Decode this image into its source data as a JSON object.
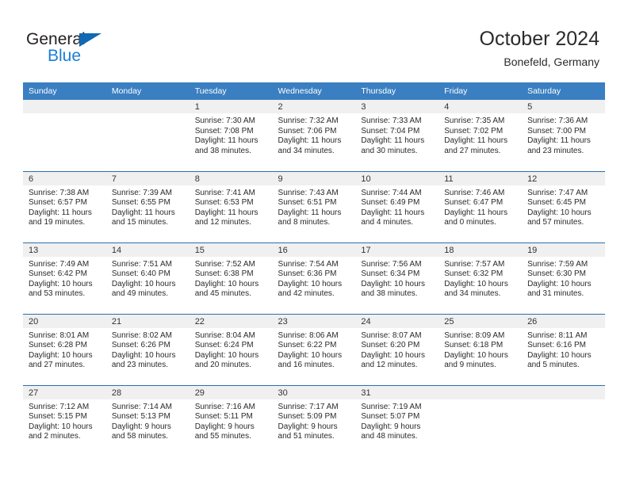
{
  "brand": {
    "name_top": "General",
    "name_bottom": "Blue",
    "color_dark": "#231f20",
    "color_blue": "#1a7fd4"
  },
  "header": {
    "title": "October 2024",
    "subtitle": "Bonefeld, Germany"
  },
  "colors": {
    "header_band": "#3a7fc1",
    "row_rule": "#2c6fae",
    "daynum_band": "#f0f0f0"
  },
  "weekdays": [
    "Sunday",
    "Monday",
    "Tuesday",
    "Wednesday",
    "Thursday",
    "Friday",
    "Saturday"
  ],
  "weeks": [
    [
      {
        "day": "",
        "empty": true
      },
      {
        "day": "",
        "empty": true
      },
      {
        "day": "1",
        "sunrise": "Sunrise: 7:30 AM",
        "sunset": "Sunset: 7:08 PM",
        "daylight": "Daylight: 11 hours and 38 minutes."
      },
      {
        "day": "2",
        "sunrise": "Sunrise: 7:32 AM",
        "sunset": "Sunset: 7:06 PM",
        "daylight": "Daylight: 11 hours and 34 minutes."
      },
      {
        "day": "3",
        "sunrise": "Sunrise: 7:33 AM",
        "sunset": "Sunset: 7:04 PM",
        "daylight": "Daylight: 11 hours and 30 minutes."
      },
      {
        "day": "4",
        "sunrise": "Sunrise: 7:35 AM",
        "sunset": "Sunset: 7:02 PM",
        "daylight": "Daylight: 11 hours and 27 minutes."
      },
      {
        "day": "5",
        "sunrise": "Sunrise: 7:36 AM",
        "sunset": "Sunset: 7:00 PM",
        "daylight": "Daylight: 11 hours and 23 minutes."
      }
    ],
    [
      {
        "day": "6",
        "sunrise": "Sunrise: 7:38 AM",
        "sunset": "Sunset: 6:57 PM",
        "daylight": "Daylight: 11 hours and 19 minutes."
      },
      {
        "day": "7",
        "sunrise": "Sunrise: 7:39 AM",
        "sunset": "Sunset: 6:55 PM",
        "daylight": "Daylight: 11 hours and 15 minutes."
      },
      {
        "day": "8",
        "sunrise": "Sunrise: 7:41 AM",
        "sunset": "Sunset: 6:53 PM",
        "daylight": "Daylight: 11 hours and 12 minutes."
      },
      {
        "day": "9",
        "sunrise": "Sunrise: 7:43 AM",
        "sunset": "Sunset: 6:51 PM",
        "daylight": "Daylight: 11 hours and 8 minutes."
      },
      {
        "day": "10",
        "sunrise": "Sunrise: 7:44 AM",
        "sunset": "Sunset: 6:49 PM",
        "daylight": "Daylight: 11 hours and 4 minutes."
      },
      {
        "day": "11",
        "sunrise": "Sunrise: 7:46 AM",
        "sunset": "Sunset: 6:47 PM",
        "daylight": "Daylight: 11 hours and 0 minutes."
      },
      {
        "day": "12",
        "sunrise": "Sunrise: 7:47 AM",
        "sunset": "Sunset: 6:45 PM",
        "daylight": "Daylight: 10 hours and 57 minutes."
      }
    ],
    [
      {
        "day": "13",
        "sunrise": "Sunrise: 7:49 AM",
        "sunset": "Sunset: 6:42 PM",
        "daylight": "Daylight: 10 hours and 53 minutes."
      },
      {
        "day": "14",
        "sunrise": "Sunrise: 7:51 AM",
        "sunset": "Sunset: 6:40 PM",
        "daylight": "Daylight: 10 hours and 49 minutes."
      },
      {
        "day": "15",
        "sunrise": "Sunrise: 7:52 AM",
        "sunset": "Sunset: 6:38 PM",
        "daylight": "Daylight: 10 hours and 45 minutes."
      },
      {
        "day": "16",
        "sunrise": "Sunrise: 7:54 AM",
        "sunset": "Sunset: 6:36 PM",
        "daylight": "Daylight: 10 hours and 42 minutes."
      },
      {
        "day": "17",
        "sunrise": "Sunrise: 7:56 AM",
        "sunset": "Sunset: 6:34 PM",
        "daylight": "Daylight: 10 hours and 38 minutes."
      },
      {
        "day": "18",
        "sunrise": "Sunrise: 7:57 AM",
        "sunset": "Sunset: 6:32 PM",
        "daylight": "Daylight: 10 hours and 34 minutes."
      },
      {
        "day": "19",
        "sunrise": "Sunrise: 7:59 AM",
        "sunset": "Sunset: 6:30 PM",
        "daylight": "Daylight: 10 hours and 31 minutes."
      }
    ],
    [
      {
        "day": "20",
        "sunrise": "Sunrise: 8:01 AM",
        "sunset": "Sunset: 6:28 PM",
        "daylight": "Daylight: 10 hours and 27 minutes."
      },
      {
        "day": "21",
        "sunrise": "Sunrise: 8:02 AM",
        "sunset": "Sunset: 6:26 PM",
        "daylight": "Daylight: 10 hours and 23 minutes."
      },
      {
        "day": "22",
        "sunrise": "Sunrise: 8:04 AM",
        "sunset": "Sunset: 6:24 PM",
        "daylight": "Daylight: 10 hours and 20 minutes."
      },
      {
        "day": "23",
        "sunrise": "Sunrise: 8:06 AM",
        "sunset": "Sunset: 6:22 PM",
        "daylight": "Daylight: 10 hours and 16 minutes."
      },
      {
        "day": "24",
        "sunrise": "Sunrise: 8:07 AM",
        "sunset": "Sunset: 6:20 PM",
        "daylight": "Daylight: 10 hours and 12 minutes."
      },
      {
        "day": "25",
        "sunrise": "Sunrise: 8:09 AM",
        "sunset": "Sunset: 6:18 PM",
        "daylight": "Daylight: 10 hours and 9 minutes."
      },
      {
        "day": "26",
        "sunrise": "Sunrise: 8:11 AM",
        "sunset": "Sunset: 6:16 PM",
        "daylight": "Daylight: 10 hours and 5 minutes."
      }
    ],
    [
      {
        "day": "27",
        "sunrise": "Sunrise: 7:12 AM",
        "sunset": "Sunset: 5:15 PM",
        "daylight": "Daylight: 10 hours and 2 minutes."
      },
      {
        "day": "28",
        "sunrise": "Sunrise: 7:14 AM",
        "sunset": "Sunset: 5:13 PM",
        "daylight": "Daylight: 9 hours and 58 minutes."
      },
      {
        "day": "29",
        "sunrise": "Sunrise: 7:16 AM",
        "sunset": "Sunset: 5:11 PM",
        "daylight": "Daylight: 9 hours and 55 minutes."
      },
      {
        "day": "30",
        "sunrise": "Sunrise: 7:17 AM",
        "sunset": "Sunset: 5:09 PM",
        "daylight": "Daylight: 9 hours and 51 minutes."
      },
      {
        "day": "31",
        "sunrise": "Sunrise: 7:19 AM",
        "sunset": "Sunset: 5:07 PM",
        "daylight": "Daylight: 9 hours and 48 minutes."
      },
      {
        "day": "",
        "empty": true
      },
      {
        "day": "",
        "empty": true
      }
    ]
  ]
}
